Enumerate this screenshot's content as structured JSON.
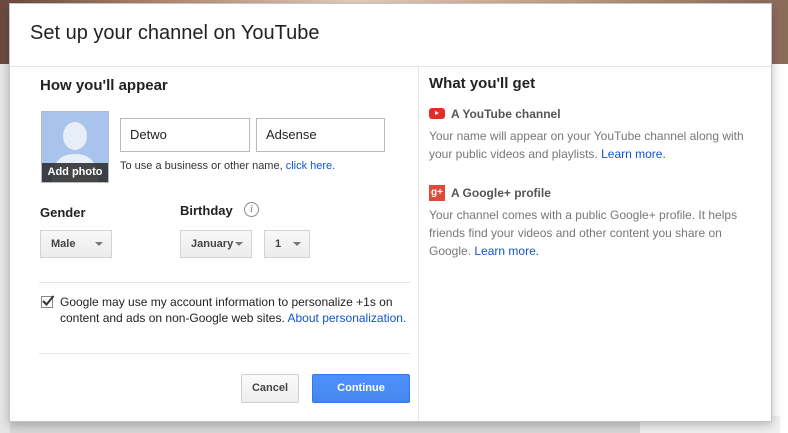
{
  "dialog": {
    "title": "Set up your channel on YouTube"
  },
  "appear": {
    "heading": "How you'll appear",
    "add_photo": "Add photo",
    "first_name": "Detwo",
    "last_name": "Adsense",
    "hint_text": "To use a business or other name,",
    "hint_link": "click here."
  },
  "gender": {
    "label": "Gender",
    "value": "Male"
  },
  "birthday": {
    "label": "Birthday",
    "info_icon": "i",
    "month": "January",
    "day": "1"
  },
  "consent": {
    "checked": true,
    "text": "Google may use my account information to personalize +1s on content and ads on non-Google web sites.",
    "link": "About personalization."
  },
  "buttons": {
    "cancel": "Cancel",
    "continue": "Continue"
  },
  "benefits": {
    "heading": "What you'll get",
    "youtube": {
      "title": "A YouTube channel",
      "text": "Your name will appear on your YouTube channel along with your public videos and playlists.",
      "link": "Learn more."
    },
    "gplus": {
      "title": "A Google+ profile",
      "icon_text": "g+",
      "text": "Your channel comes with a public Google+ profile. It helps friends find your videos and other content you share on Google.",
      "link": "Learn more."
    }
  },
  "colors": {
    "accent": "#4d90fe",
    "link": "#1155cc",
    "youtube_red": "#e52d27",
    "gplus_red": "#dd4b39"
  }
}
